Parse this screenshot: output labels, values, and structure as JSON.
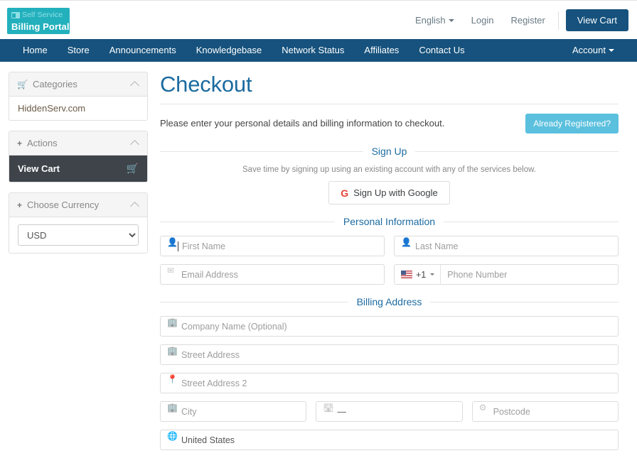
{
  "header": {
    "logo": {
      "line1": "Self Service",
      "line2": "Billing Portal",
      "icon": "building-icon"
    },
    "language": "English",
    "login": "Login",
    "register": "Register",
    "view_cart": "View Cart"
  },
  "nav": {
    "items": [
      {
        "label": "Home"
      },
      {
        "label": "Store"
      },
      {
        "label": "Announcements"
      },
      {
        "label": "Knowledgebase"
      },
      {
        "label": "Network Status"
      },
      {
        "label": "Affiliates"
      },
      {
        "label": "Contact Us"
      }
    ],
    "account": "Account"
  },
  "sidebar": {
    "categories": {
      "title": "Categories",
      "icon": "cart-icon",
      "items": [
        {
          "label": "HiddenServ.com"
        }
      ]
    },
    "actions": {
      "title": "Actions",
      "icon": "plus-icon",
      "items": [
        {
          "label": "View Cart",
          "icon": "cart-icon",
          "active": true
        }
      ]
    },
    "currency": {
      "title": "Choose Currency",
      "icon": "plus-icon",
      "selected": "USD",
      "options": [
        "USD"
      ]
    }
  },
  "main": {
    "title": "Checkout",
    "intro": "Please enter your personal details and billing information to checkout.",
    "already_registered": "Already Registered?",
    "signup": {
      "legend": "Sign Up",
      "note": "Save time by signing up using an existing account with any of the services below.",
      "google_button": "Sign Up with Google",
      "google_icon": "google-g-icon"
    },
    "personal": {
      "legend": "Personal Information",
      "first_name": {
        "placeholder": "First Name",
        "value": "",
        "icon": "user-icon",
        "focused": true
      },
      "last_name": {
        "placeholder": "Last Name",
        "value": "",
        "icon": "user-icon"
      },
      "email": {
        "placeholder": "Email Address",
        "value": "",
        "icon": "envelope-icon"
      },
      "phone": {
        "placeholder": "Phone Number",
        "value": "",
        "dial_code": "+1",
        "flag": "us-flag-icon"
      }
    },
    "billing": {
      "legend": "Billing Address",
      "company": {
        "placeholder": "Company Name (Optional)",
        "value": "",
        "icon": "building-icon"
      },
      "street1": {
        "placeholder": "Street Address",
        "value": "",
        "icon": "building-icon"
      },
      "street2": {
        "placeholder": "Street Address 2",
        "value": "",
        "icon": "map-pin-icon"
      },
      "city": {
        "placeholder": "City",
        "value": "",
        "icon": "building-icon"
      },
      "state": {
        "placeholder": "",
        "value": "—",
        "icon": "signpost-icon"
      },
      "postcode": {
        "placeholder": "Postcode",
        "value": "",
        "icon": "gear-icon"
      },
      "country": {
        "placeholder": "",
        "value": "United States",
        "icon": "globe-icon"
      }
    }
  },
  "colors": {
    "navbar": "#16527d",
    "logo": "#23b0bd",
    "accent_light_blue": "#5bc0de",
    "title_blue": "#1c6ba0",
    "active_item": "#3e444a"
  }
}
